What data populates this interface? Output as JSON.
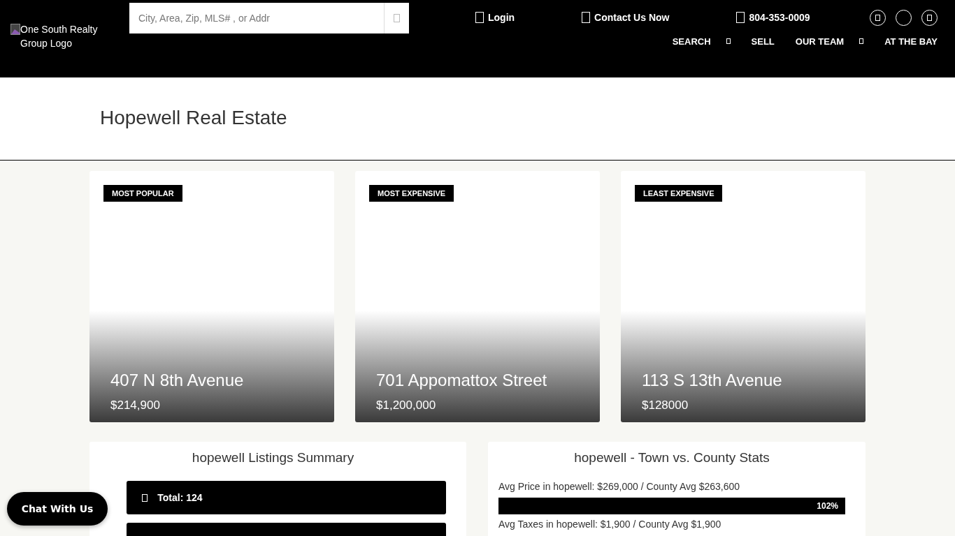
{
  "header": {
    "logo_alt": "One South Realty Group Logo",
    "search": {
      "placeholder": "City, Area, Zip, MLS# , or Addr"
    },
    "top_links": [
      {
        "label": "Login"
      },
      {
        "label": "Contact Us Now"
      },
      {
        "label": "804-353-0009"
      }
    ],
    "nav": [
      {
        "label": "SEARCH",
        "dropdown": true
      },
      {
        "label": "SELL",
        "dropdown": false
      },
      {
        "label": "OUR TEAM",
        "dropdown": true
      },
      {
        "label": "AT THE BAY",
        "dropdown": false
      }
    ]
  },
  "page_title": "Hopewell Real Estate",
  "featured": [
    {
      "badge": "MOST POPULAR",
      "address": "407 N 8th Avenue",
      "price": "$214,900"
    },
    {
      "badge": "MOST EXPENSIVE",
      "address": "701 Appomattox Street",
      "price": "$1,200,000"
    },
    {
      "badge": "LEAST EXPENSIVE",
      "address": "113 S 13th Avenue",
      "price": "$128000"
    }
  ],
  "summary": {
    "title": "hopewell Listings Summary",
    "items": [
      {
        "kind": "count",
        "label": "Total: 124"
      },
      {
        "kind": "blank"
      }
    ]
  },
  "stats": {
    "title": "hopewell - Town vs. County Stats",
    "rows": [
      {
        "label": "Avg Price in hopewell: $269,000 / County Avg $263,600",
        "level": 1,
        "reading": "102%"
      },
      {
        "label": "Avg Taxes in hopewell: $1,900 / County Avg $1,900"
      }
    ]
  },
  "chat_button": "Chat With Us"
}
